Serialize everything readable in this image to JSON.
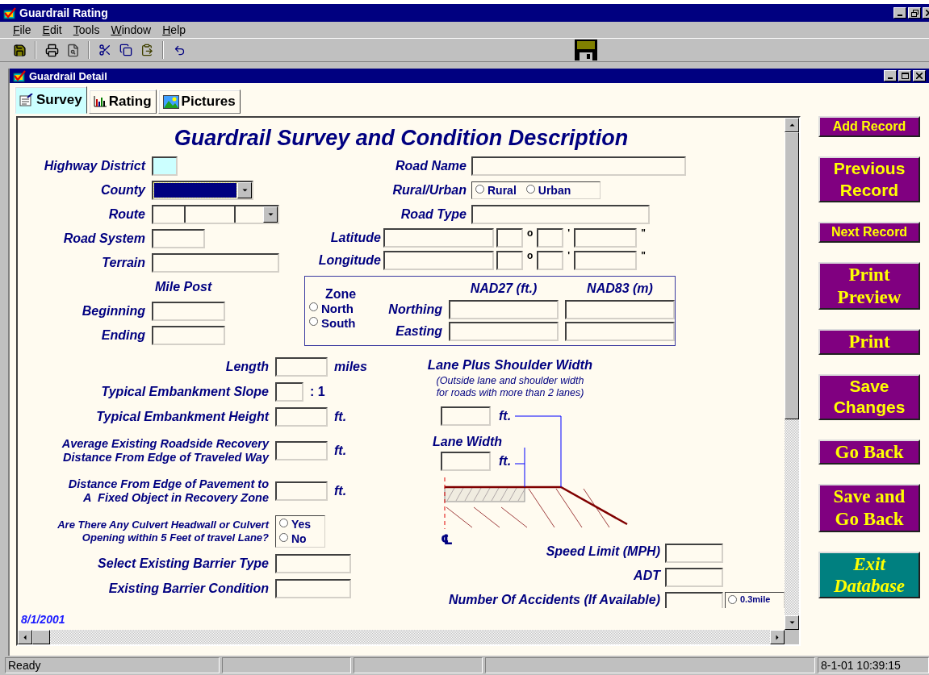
{
  "app_window": {
    "title": "Guardrail Rating"
  },
  "menu": [
    {
      "label": "File"
    },
    {
      "label": "Edit"
    },
    {
      "label": "Tools"
    },
    {
      "label": "Window"
    },
    {
      "label": "Help"
    }
  ],
  "child_window": {
    "title": "Guardrail Detail"
  },
  "tabs": [
    {
      "label": "Survey",
      "selected": true
    },
    {
      "label": "Rating",
      "selected": false
    },
    {
      "label": "Pictures",
      "selected": false
    }
  ],
  "form": {
    "title": "Guardrail Survey and Condition Description",
    "location_fields": [
      {
        "label": "Highway District",
        "kind": "text",
        "focused": true
      },
      {
        "label": "County",
        "kind": "combo",
        "focused": false,
        "highlighted": true
      },
      {
        "label": "Route",
        "kind": "route",
        "focused": false
      },
      {
        "label": "Road System",
        "kind": "text",
        "focused": false
      },
      {
        "label": "Terrain",
        "kind": "text",
        "focused": false
      }
    ],
    "mile_post": {
      "heading": "Mile Post",
      "fields": [
        {
          "label": "Beginning"
        },
        {
          "label": "Ending"
        }
      ]
    },
    "road_fields": [
      {
        "label": "Road Name",
        "kind": "text"
      },
      {
        "label": "Rural/Urban",
        "kind": "radio",
        "options": [
          {
            "label": "Rural",
            "selected": false
          },
          {
            "label": "Urban",
            "selected": false
          }
        ]
      },
      {
        "label": "Road Type",
        "kind": "text"
      }
    ],
    "coordinates": [
      {
        "label": "Latitude",
        "marks": [
          "o",
          "'",
          "\""
        ]
      },
      {
        "label": "Longitude",
        "marks": [
          "o",
          "'",
          "\""
        ]
      }
    ],
    "state_plane": {
      "zone_label": "Zone",
      "zones": [
        {
          "label": "North",
          "selected": false
        },
        {
          "label": "South",
          "selected": false
        }
      ],
      "columns": [
        "NAD27 (ft.)",
        "NAD83 (m)"
      ],
      "rows": [
        {
          "label": "Northing"
        },
        {
          "label": "Easting"
        }
      ]
    },
    "measurements": [
      {
        "label": "Length",
        "kind": "text",
        "unit": "miles"
      },
      {
        "label": "Typical Embankment Slope",
        "kind": "short",
        "unit": ": 1"
      },
      {
        "label": "Typical Embankment Height",
        "kind": "text",
        "unit": "ft."
      },
      {
        "label": "Average Existing Roadside Recovery\nDistance From Edge of Traveled Way",
        "kind": "text",
        "unit": "ft."
      },
      {
        "label": "Distance From Edge of Pavement to\nA  Fixed Object in Recovery Zone",
        "kind": "text",
        "unit": "ft."
      },
      {
        "label": "Are There Any Culvert Headwall or Culvert\nOpening within 5 Feet of travel Lane?",
        "kind": "radio",
        "options": [
          {
            "label": "Yes",
            "selected": false
          },
          {
            "label": "No",
            "selected": false
          }
        ]
      },
      {
        "label": "Select Existing Barrier Type",
        "kind": "wide"
      },
      {
        "label": "Existing Barrier Condition",
        "kind": "wide"
      }
    ],
    "lane": {
      "heading": "Lane Plus Shoulder Width",
      "note": "(Outside lane and shoulder width\nfor roads with more than 2 lanes)",
      "shoulder_unit": "ft.",
      "lane_heading": "Lane Width",
      "lane_unit": "ft.",
      "centerline_symbol": "℄"
    },
    "traffic": [
      {
        "label": "Speed Limit (MPH)"
      },
      {
        "label": "ADT"
      },
      {
        "label": "Number Of Accidents (If Available)",
        "options": [
          {
            "label": "0.3mile",
            "selected": false
          }
        ]
      }
    ],
    "date": "8/1/2001"
  },
  "actions": [
    {
      "label": "Add Record",
      "kind": "small",
      "color": "#800080"
    },
    {
      "label": "Previous Record",
      "kind": "sans",
      "color": "#800080"
    },
    {
      "label": "Next Record",
      "kind": "small",
      "color": "#800080"
    },
    {
      "label": "Print Preview",
      "kind": "serif",
      "color": "#800080"
    },
    {
      "label": "Print",
      "kind": "serif",
      "color": "#800080"
    },
    {
      "label": "Save Changes",
      "kind": "sans",
      "color": "#800080"
    },
    {
      "label": "Go Back",
      "kind": "serif",
      "color": "#800080"
    },
    {
      "label": "Save and Go Back",
      "kind": "serif",
      "color": "#800080"
    },
    {
      "label": "Exit Database",
      "kind": "exit",
      "color": "#008080"
    }
  ],
  "status_bar": {
    "message": "Ready",
    "clock": "8-1-01 10:39:15"
  }
}
